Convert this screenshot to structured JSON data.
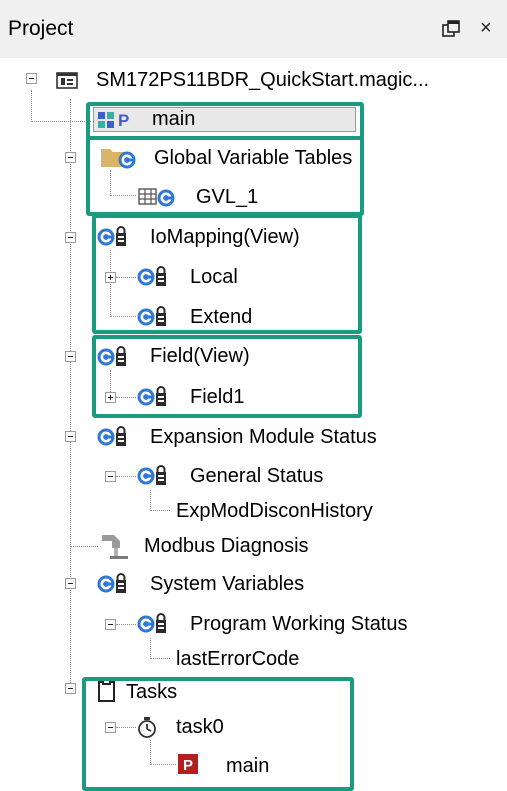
{
  "header": {
    "title": "Project",
    "float_icon": "float-window-icon",
    "close_label": "×"
  },
  "tree": {
    "root": {
      "label": "SM172PS11BDR_QuickStart.magic...",
      "icon": "project-icon"
    },
    "main_program": {
      "label": "main",
      "icon": "program-icon"
    },
    "global_variable_tables": {
      "label": "Global Variable Tables",
      "icon": "folder-gvl-icon"
    },
    "gvl_1": {
      "label": "GVL_1",
      "icon": "gvl-table-icon"
    },
    "iomapping_view": {
      "label": "IoMapping(View)",
      "icon": "locked-io-icon"
    },
    "local": {
      "label": "Local",
      "icon": "locked-io-icon"
    },
    "extend": {
      "label": "Extend",
      "icon": "locked-io-icon"
    },
    "field_view": {
      "label": "Field(View)",
      "icon": "locked-io-icon"
    },
    "field1": {
      "label": "Field1",
      "icon": "locked-io-icon"
    },
    "expansion_module_status": {
      "label": "Expansion Module Status",
      "icon": "locked-io-icon"
    },
    "general_status": {
      "label": "General Status",
      "icon": "locked-io-icon"
    },
    "exp_mod_discon_history": {
      "label": "ExpModDisconHistory"
    },
    "modbus_diagnosis": {
      "label": "Modbus Diagnosis",
      "icon": "modbus-icon"
    },
    "system_variables": {
      "label": "System Variables",
      "icon": "locked-io-icon"
    },
    "program_working_status": {
      "label": "Program Working Status",
      "icon": "locked-io-icon"
    },
    "last_error_code": {
      "label": "lastErrorCode"
    },
    "tasks": {
      "label": "Tasks",
      "icon": "clipboard-icon"
    },
    "task0": {
      "label": "task0",
      "icon": "stopwatch-icon"
    },
    "task_main": {
      "label": "main",
      "icon": "program-p-icon"
    }
  },
  "colors": {
    "highlight_border": "#1a9b7f",
    "header_bg": "#f0f0f0",
    "gear_blue": "#2f78d6",
    "lock_dark": "#2a2a2a",
    "program_red": "#b41e1e"
  }
}
